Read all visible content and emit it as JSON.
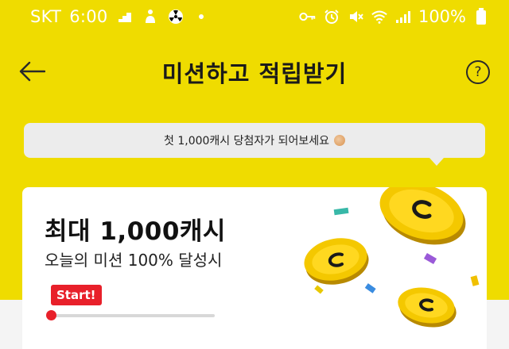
{
  "status_bar": {
    "carrier": "SKT",
    "time": "6:00",
    "battery": "100%",
    "left_icons": [
      "staircase-icon",
      "person-icon",
      "radiation-icon",
      "dot-icon"
    ],
    "right_icons": [
      "key-icon",
      "alarm-icon",
      "mute-icon",
      "wifi-icon",
      "signal-icon",
      "battery-icon"
    ]
  },
  "header": {
    "title": "미션하고 적립받기",
    "help": "?"
  },
  "tooltip": {
    "text": "첫 1,000캐시 당첨자가 되어보세요"
  },
  "card": {
    "title": "최대 1,000캐시",
    "subtitle": "오늘의 미션 100% 달성시",
    "badge": "Start!",
    "progress": 0
  },
  "colors": {
    "brand_yellow": "#efdc00",
    "start_red": "#e8202a",
    "coin_gold": "#f2c200"
  }
}
